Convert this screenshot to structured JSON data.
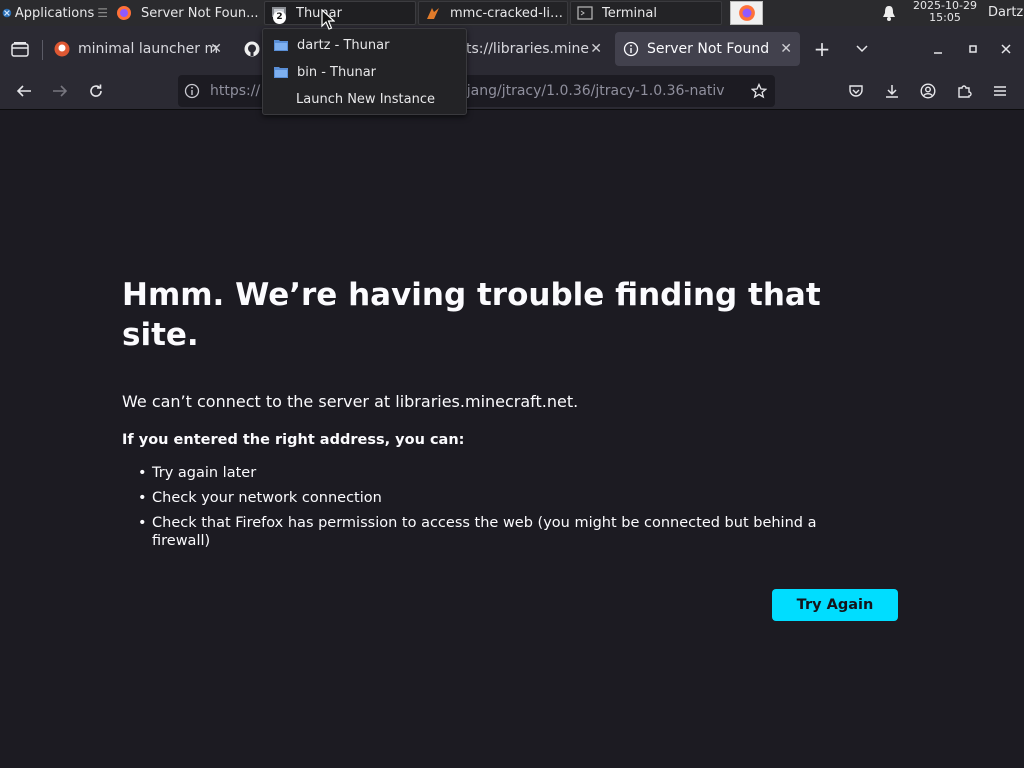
{
  "panel": {
    "apps_label": "Applications",
    "tasks": [
      {
        "label": "Server Not Foun...",
        "icon": "firefox-icon"
      },
      {
        "label": "Thunar",
        "icon": "file-manager-icon",
        "group_count": "2"
      },
      {
        "label": "mmc-cracked-lin...",
        "icon": "java-icon"
      },
      {
        "label": "Terminal",
        "icon": "terminal-icon"
      }
    ],
    "date": "2025-10-29",
    "time": "15:05",
    "user": "Dartz"
  },
  "dropdown": {
    "items": [
      {
        "label": "dartz - Thunar",
        "icon": "folder-icon"
      },
      {
        "label": "bin - Thunar",
        "icon": "folder-icon"
      },
      {
        "label": "Launch New Instance"
      }
    ]
  },
  "tabs": [
    {
      "label": "minimal launcher m",
      "icon": "duckduckgo-icon"
    },
    {
      "label": "",
      "icon": "github-icon"
    },
    {
      "label": "ts://libraries.mine",
      "icon": "none"
    },
    {
      "label": "Server Not Found",
      "icon": "info-icon",
      "active": true
    }
  ],
  "urlbar": {
    "prefix": "https://",
    "suffix": "ojang/jtracy/1.0.36/jtracy-1.0.36-nativ"
  },
  "error": {
    "title": "Hmm. We’re having trouble finding that site.",
    "description": "We can’t connect to the server at libraries.minecraft.net.",
    "subtitle": "If you entered the right address, you can:",
    "suggestions": [
      "Try again later",
      "Check your network connection",
      "Check that Firefox has permission to access the web (you might be connected but behind a firewall)"
    ],
    "button": "Try Again"
  },
  "colors": {
    "accent": "#00ddff",
    "page_bg": "#1c1b22",
    "toolbar_bg": "#2b2a33",
    "panel_bg": "#2b2b2e"
  }
}
